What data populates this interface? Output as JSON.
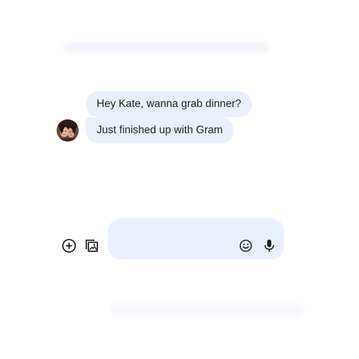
{
  "conversation": {
    "messages": [
      {
        "text": "Hey Kate, wanna grab dinner?"
      },
      {
        "text": "Just finished up with Gram"
      }
    ]
  },
  "composer": {
    "icons": [
      "add-icon",
      "gallery-icon",
      "emoji-icon",
      "mic-icon"
    ]
  },
  "colors": {
    "bubble": "#eaf0fb",
    "text": "#1f1f1f",
    "icon": "#1f1f1f"
  }
}
